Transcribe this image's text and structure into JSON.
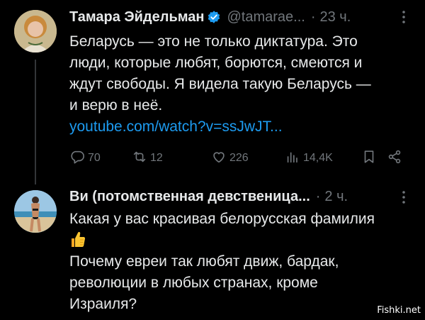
{
  "tweet1": {
    "author_name": "Тамара Эйдельман",
    "handle": "@tamarae...",
    "separator": "·",
    "time": "23 ч.",
    "lines": [
      "Беларусь — это не только диктатура.  Это",
      "люди, которые любят, борются, смеются и",
      "ждут свободы. Я видела такую Беларусь —",
      "и верю в неё."
    ],
    "link": "youtube.com/watch?v=ssJwJT...",
    "actions": {
      "replies": "70",
      "reposts": "12",
      "likes": "226",
      "views": "14,4K"
    }
  },
  "tweet2": {
    "author_name": "Ви (потомственная девственица...",
    "separator": "·",
    "time": "2 ч.",
    "lines_a": [
      "Какая у вас красивая белорусская фамилия"
    ],
    "emoji": "thumbs-up",
    "lines_b": [
      "Почему евреи так любят движ, бардак,",
      "революции в любых странах, кроме",
      "Израиля?"
    ]
  },
  "watermark": "Fishki.net",
  "colors": {
    "background": "#000000",
    "text": "#e7e9ea",
    "muted": "#71767b",
    "link": "#1d9bf0",
    "verified": "#1d9bf0"
  }
}
